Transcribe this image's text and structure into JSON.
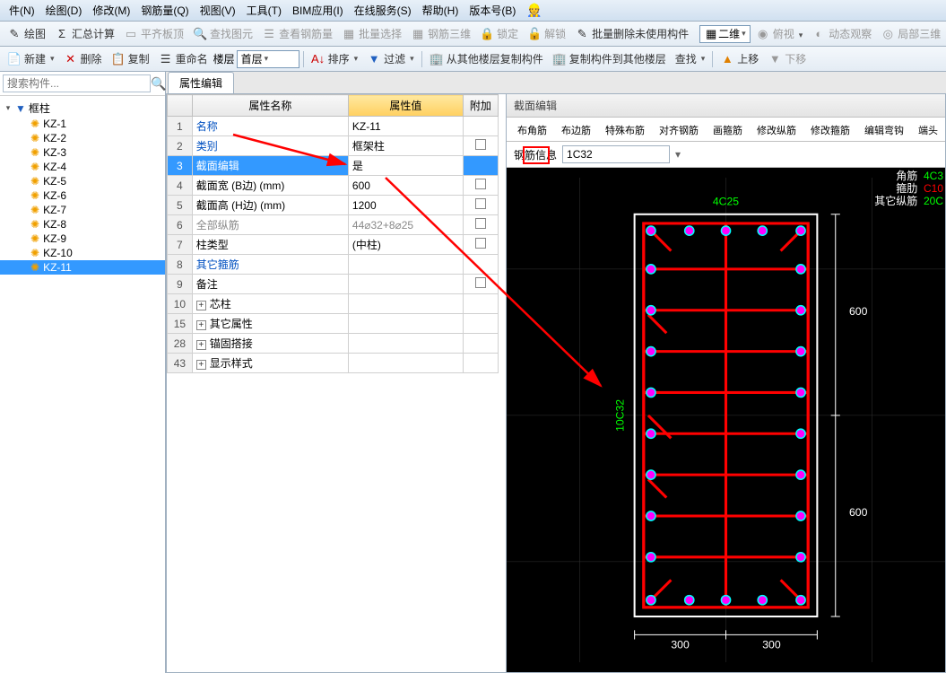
{
  "menu": [
    "件(N)",
    "绘图(D)",
    "修改(M)",
    "钢筋量(Q)",
    "视图(V)",
    "工具(T)",
    "BIM应用(I)",
    "在线服务(S)",
    "帮助(H)",
    "版本号(B)"
  ],
  "toolbar1": {
    "items": [
      "绘图",
      "汇总计算",
      "平齐板顶",
      "查找图元",
      "查看钢筋量",
      "批量选择",
      "钢筋三维",
      "锁定",
      "解锁",
      "批量删除未使用构件"
    ],
    "view_mode": "二维",
    "right_items": [
      "俯视",
      "动态观察",
      "局部三维"
    ]
  },
  "toolbar2": {
    "new": "新建",
    "del": "删除",
    "copy": "复制",
    "rename": "重命名",
    "floor_lbl": "楼层",
    "floor_val": "首层",
    "sort": "排序",
    "filter": "过滤",
    "copy_from": "从其他楼层复制构件",
    "copy_to": "复制构件到其他楼层",
    "find": "查找",
    "up": "上移",
    "down": "下移"
  },
  "search_placeholder": "搜索构件...",
  "tree": {
    "root": "框柱",
    "items": [
      "KZ-1",
      "KZ-2",
      "KZ-3",
      "KZ-4",
      "KZ-5",
      "KZ-6",
      "KZ-7",
      "KZ-8",
      "KZ-9",
      "KZ-10",
      "KZ-11"
    ],
    "selected": "KZ-11"
  },
  "prop_tab": "属性编辑",
  "prop_headers": {
    "name": "属性名称",
    "value": "属性值",
    "extra": "附加"
  },
  "prop_rows": [
    {
      "n": "1",
      "name": "名称",
      "val": "KZ-11",
      "link": true,
      "chk": false
    },
    {
      "n": "2",
      "name": "类别",
      "val": "框架柱",
      "link": true,
      "chk": true
    },
    {
      "n": "3",
      "name": "截面编辑",
      "val": "是",
      "link": false,
      "chk": false,
      "selected": true
    },
    {
      "n": "4",
      "name": "截面宽 (B边) (mm)",
      "val": "600",
      "chk": true
    },
    {
      "n": "5",
      "name": "截面高 (H边) (mm)",
      "val": "1200",
      "chk": true
    },
    {
      "n": "6",
      "name": "全部纵筋",
      "val": "44⌀32+8⌀25",
      "gray": true,
      "chk": true
    },
    {
      "n": "7",
      "name": "柱类型",
      "val": "(中柱)",
      "chk": true
    },
    {
      "n": "8",
      "name": "其它箍筋",
      "val": "",
      "link": true,
      "chk": false
    },
    {
      "n": "9",
      "name": "备注",
      "val": "",
      "chk": true
    },
    {
      "n": "10",
      "name": "芯柱",
      "val": "",
      "expand": true
    },
    {
      "n": "15",
      "name": "其它属性",
      "val": "",
      "expand": true
    },
    {
      "n": "28",
      "name": "锚固搭接",
      "val": "",
      "expand": true
    },
    {
      "n": "43",
      "name": "显示样式",
      "val": "",
      "expand": true
    }
  ],
  "section": {
    "title": "截面编辑",
    "tabs": [
      "布角筋",
      "布边筋",
      "特殊布筋",
      "对齐钢筋",
      "画箍筋",
      "修改纵筋",
      "修改箍筋",
      "编辑弯钩",
      "端头"
    ],
    "info_label": "钢筋信息",
    "info_value": "1C32",
    "dims": {
      "top": "4C25",
      "side_top": "600",
      "side_bot": "600",
      "bot_l": "300",
      "bot_r": "300",
      "left_label": "10C32"
    },
    "legend": {
      "corner": "角筋",
      "corner_v": "4C3",
      "stirrup": "箍肋",
      "stirrup_v": "C10",
      "other": "其它纵筋",
      "other_v": "20C"
    }
  }
}
